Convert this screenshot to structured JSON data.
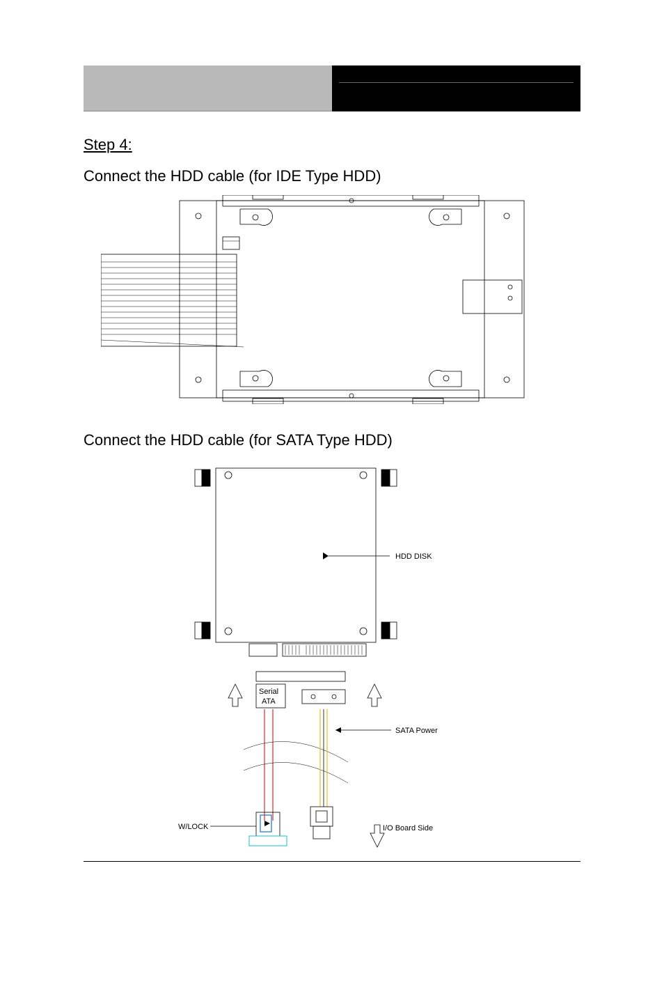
{
  "step": {
    "title": "Step 4:"
  },
  "captions": {
    "ide": "Connect the HDD cable (for IDE Type HDD)",
    "sata": "Connect the HDD cable (for SATA Type HDD)"
  },
  "diagram2": {
    "serial_ata": "Serial\nATA",
    "hdd_disk": "HDD DISK",
    "sata_power": "SATA Power",
    "wlock": "W/LOCK",
    "io_board_side": "I/O Board Side"
  }
}
